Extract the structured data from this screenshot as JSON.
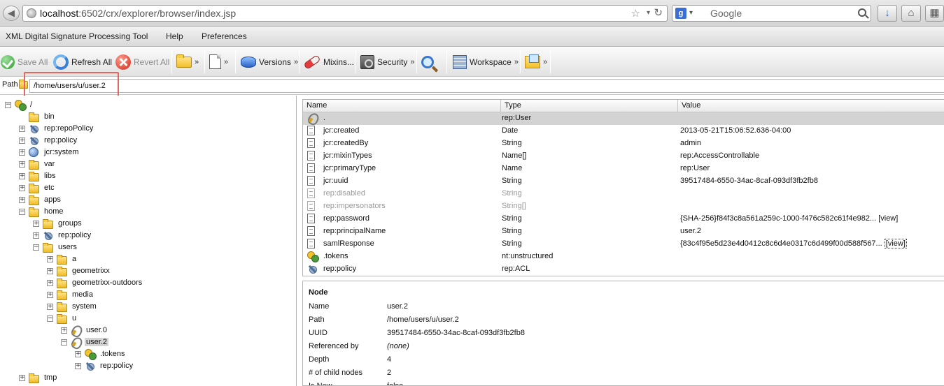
{
  "browser": {
    "url_host": "localhost",
    "url_rest": ":6502/crx/explorer/browser/index.jsp",
    "search_engine": "Google",
    "search_placeholder": "Google"
  },
  "menu": [
    "XML Digital Signature Processing Tool",
    "Help",
    "Preferences"
  ],
  "toolbar": {
    "save_all": "Save All",
    "refresh_all": "Refresh All",
    "revert_all": "Revert All",
    "more": "»",
    "versions": "Versions",
    "mixins": "Mixins...",
    "security": "Security",
    "workspace": "Workspace"
  },
  "path": {
    "label": "Path",
    "value": "/home/users/u/user.2"
  },
  "tree": {
    "nodes": [
      {
        "label": "/",
        "toggle": "−",
        "icon": "root-node-icon"
      },
      {
        "label": "bin",
        "toggle": "",
        "icon": "folder-icon"
      },
      {
        "label": "rep:repoPolicy",
        "toggle": "+",
        "icon": "policy-icon"
      },
      {
        "label": "rep:policy",
        "toggle": "+",
        "icon": "policy-icon"
      },
      {
        "label": "jcr:system",
        "toggle": "+",
        "icon": "system-globe-icon"
      },
      {
        "label": "var",
        "toggle": "+",
        "icon": "folder-icon"
      },
      {
        "label": "libs",
        "toggle": "+",
        "icon": "folder-icon"
      },
      {
        "label": "etc",
        "toggle": "+",
        "icon": "folder-icon"
      },
      {
        "label": "apps",
        "toggle": "+",
        "icon": "folder-icon"
      },
      {
        "label": "home",
        "toggle": "−",
        "icon": "folder-icon"
      },
      {
        "label": "groups",
        "toggle": "+",
        "icon": "folder-icon"
      },
      {
        "label": "rep:policy",
        "toggle": "+",
        "icon": "policy-icon"
      },
      {
        "label": "users",
        "toggle": "−",
        "icon": "folder-icon"
      },
      {
        "label": "a",
        "toggle": "+",
        "icon": "folder-icon"
      },
      {
        "label": "geometrixx",
        "toggle": "+",
        "icon": "folder-icon"
      },
      {
        "label": "geometrixx-outdoors",
        "toggle": "+",
        "icon": "folder-icon"
      },
      {
        "label": "media",
        "toggle": "+",
        "icon": "folder-icon"
      },
      {
        "label": "system",
        "toggle": "+",
        "icon": "folder-icon"
      },
      {
        "label": "u",
        "toggle": "−",
        "icon": "folder-icon"
      },
      {
        "label": "user.0",
        "toggle": "+",
        "icon": "user-icon"
      },
      {
        "label": "user.2",
        "toggle": "−",
        "icon": "user-icon",
        "selected": true
      },
      {
        "label": ".tokens",
        "toggle": "+",
        "icon": "tokens-icon"
      },
      {
        "label": "rep:policy",
        "toggle": "+",
        "icon": "policy-icon"
      },
      {
        "label": "tmp",
        "toggle": "+",
        "icon": "folder-icon"
      }
    ]
  },
  "properties": {
    "headers": [
      "Name",
      "Type",
      "Value"
    ],
    "rows": [
      {
        "name": ".",
        "type": "rep:User",
        "value": "",
        "icon": "user-icon",
        "selected": true
      },
      {
        "name": "jcr:created",
        "type": "Date",
        "value": "2013-05-21T15:06:52.636-04:00",
        "icon": "property-icon"
      },
      {
        "name": "jcr:createdBy",
        "type": "String",
        "value": "admin",
        "icon": "property-icon"
      },
      {
        "name": "jcr:mixinTypes",
        "type": "Name[]",
        "value": "rep:AccessControllable",
        "icon": "property-icon"
      },
      {
        "name": "jcr:primaryType",
        "type": "Name",
        "value": "rep:User",
        "icon": "property-icon"
      },
      {
        "name": "jcr:uuid",
        "type": "String",
        "value": "39517484-6550-34ac-8caf-093df3fb2fb8",
        "icon": "property-icon"
      },
      {
        "name": "rep:disabled",
        "type": "String",
        "value": "",
        "icon": "property-icon",
        "dimmed": true
      },
      {
        "name": "rep:impersonators",
        "type": "String[]",
        "value": "",
        "icon": "property-icon",
        "dimmed": true
      },
      {
        "name": "rep:password",
        "type": "String",
        "value": "{SHA-256}f84f3c8a561a259c-1000-f476c582c61f4e982...",
        "link": "[view]",
        "icon": "property-icon"
      },
      {
        "name": "rep:principalName",
        "type": "String",
        "value": "user.2",
        "icon": "property-icon"
      },
      {
        "name": "samlResponse",
        "type": "String",
        "value": "{83c4f95e5d23e4d0412c8c6d4e0317c6d499f00d588f567...",
        "link": "[view]",
        "link_boxed": true,
        "icon": "property-icon"
      },
      {
        "name": ".tokens",
        "type": "nt:unstructured",
        "value": "",
        "icon": "tokens-icon"
      },
      {
        "name": "rep:policy",
        "type": "rep:ACL",
        "value": "",
        "icon": "policy-icon"
      }
    ]
  },
  "node": {
    "title": "Node",
    "rows": [
      {
        "key": "Name",
        "value": "user.2"
      },
      {
        "key": "Path",
        "value": "/home/users/u/user.2"
      },
      {
        "key": "UUID",
        "value": "39517484-6550-34ac-8caf-093df3fb2fb8"
      },
      {
        "key": "Referenced by",
        "value": "(none)",
        "italic": true
      },
      {
        "key": "Depth",
        "value": "4"
      },
      {
        "key": "# of child nodes",
        "value": "2"
      },
      {
        "key": "Is New",
        "value": "false"
      }
    ]
  },
  "colors": {
    "highlight_box": "#e3675c",
    "selection": "#d3d3d3"
  }
}
